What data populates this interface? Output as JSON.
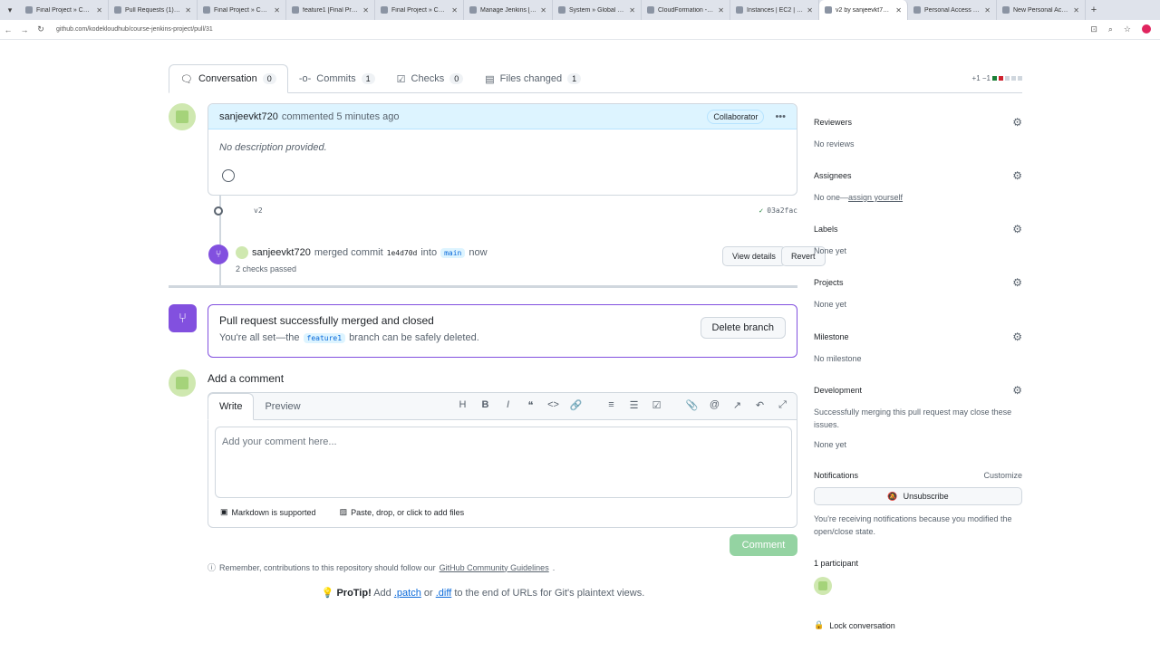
{
  "browser": {
    "tabs": [
      {
        "title": "Final Project » Code-C..."
      },
      {
        "title": "Pull Requests (1) [Final..."
      },
      {
        "title": "Final Project » Code-C..."
      },
      {
        "title": "feature1 [Final Project..."
      },
      {
        "title": "Final Project » Code-C..."
      },
      {
        "title": "Manage Jenkins [Jenkin..."
      },
      {
        "title": "System » Global creden..."
      },
      {
        "title": "CloudFormation - Stac..."
      },
      {
        "title": "Instances | EC2 | us-ea..."
      },
      {
        "title": "v2 by sanjeevkt720 · P..."
      },
      {
        "title": "Personal Access Token..."
      },
      {
        "title": "New Personal Access T..."
      }
    ],
    "url": "github.com/kodekloudhub/course-jenkins-project/pull/31"
  },
  "pr_tabs": [
    {
      "label": "Conversation",
      "count": "0"
    },
    {
      "label": "Commits",
      "count": "1"
    },
    {
      "label": "Checks",
      "count": "0"
    },
    {
      "label": "Files changed",
      "count": "1"
    }
  ],
  "diffstat": "+1 −1",
  "comment": {
    "author": "sanjeevkt720",
    "action": "commented",
    "time": "5 minutes ago",
    "badge": "Collaborator",
    "body": "No description provided."
  },
  "commit": {
    "message": "v2",
    "sha": "03a2fac"
  },
  "merge_event": {
    "author": "sanjeevkt720",
    "text1": "merged commit",
    "sha": "1e4d70d",
    "text2": "into",
    "branch": "main",
    "time": "now",
    "checks": "2 checks passed",
    "view_details": "View details",
    "revert": "Revert"
  },
  "merged_box": {
    "title": "Pull request successfully merged and closed",
    "text1": "You're all set—the",
    "branch": "feature1",
    "text2": "branch can be safely deleted.",
    "delete_label": "Delete branch"
  },
  "add_comment": {
    "title": "Add a comment",
    "write_tab": "Write",
    "preview_tab": "Preview",
    "placeholder": "Add your comment here...",
    "markdown": "Markdown is supported",
    "files": "Paste, drop, or click to add files",
    "submit": "Comment"
  },
  "remember": {
    "text": "Remember, contributions to this repository should follow our",
    "link": "GitHub Community Guidelines",
    "end": "."
  },
  "protip": {
    "label": "ProTip!",
    "t1": "Add",
    "patch": ".patch",
    "t2": "or",
    "diff": ".diff",
    "t3": "to the end of URLs for Git's plaintext views."
  },
  "sidebar": {
    "reviewers": {
      "title": "Reviewers",
      "value": "No reviews"
    },
    "assignees": {
      "title": "Assignees",
      "value": "No one—",
      "link": "assign yourself"
    },
    "labels": {
      "title": "Labels",
      "value": "None yet"
    },
    "projects": {
      "title": "Projects",
      "value": "None yet"
    },
    "milestone": {
      "title": "Milestone",
      "value": "No milestone"
    },
    "development": {
      "title": "Development",
      "value": "Successfully merging this pull request may close these issues.",
      "value2": "None yet"
    },
    "notifications": {
      "title": "Notifications",
      "customize": "Customize",
      "button": "Unsubscribe",
      "note": "You're receiving notifications because you modified the open/close state."
    },
    "participants": {
      "title": "1 participant"
    },
    "lock": "Lock conversation"
  }
}
